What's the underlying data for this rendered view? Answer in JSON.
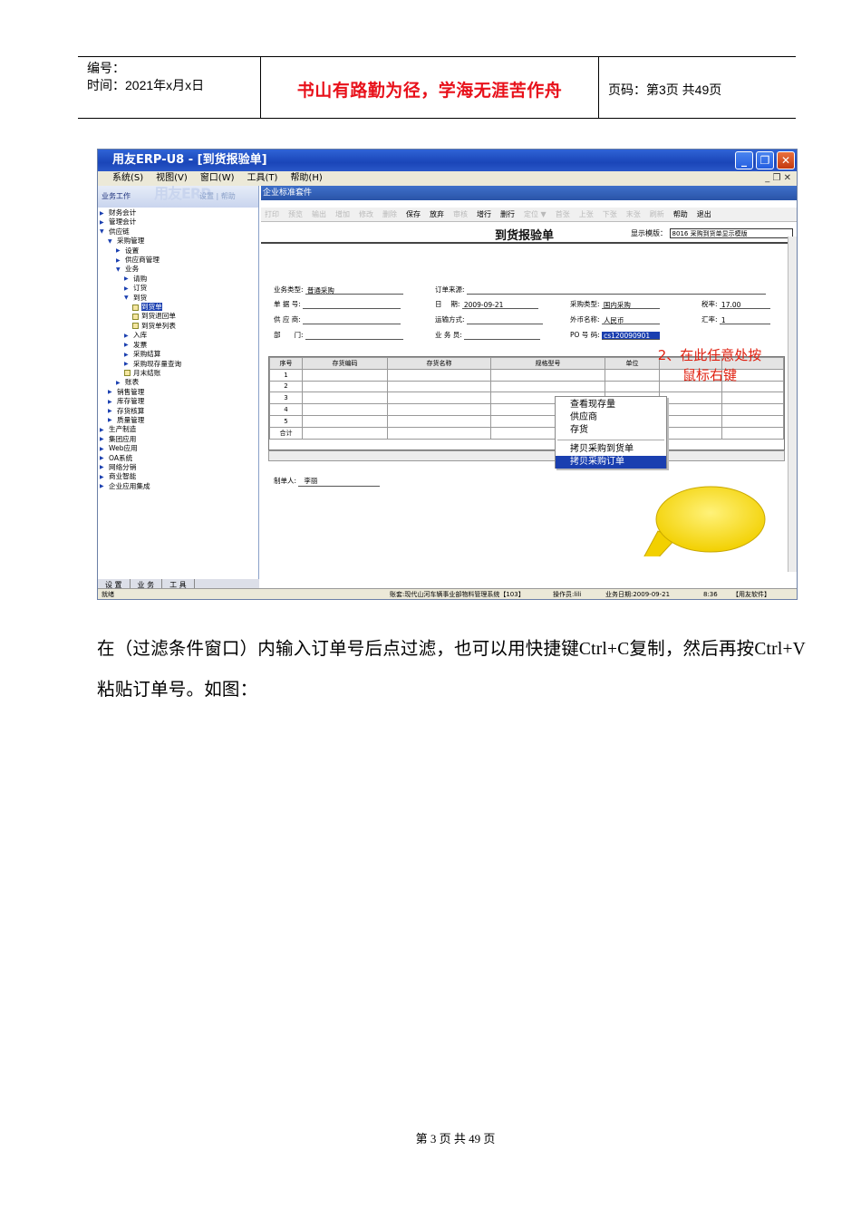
{
  "header": {
    "serial_label": "编号：",
    "time_label": "时间：2021年x月x日",
    "motto": "书山有路勤为径，学海无涯苦作舟",
    "page_info": "页码：第3页 共49页"
  },
  "app": {
    "window_title": "用友ERP-U8 - [到货报验单]",
    "menus": [
      "系统(S)",
      "视图(V)",
      "窗口(W)",
      "工具(T)",
      "帮助(H)"
    ],
    "menu_right": "_ ❐ ✕",
    "sidebar_title": "业务工作",
    "sidebar_links": "设置 | 帮助",
    "sidebar_logo": "用友ERP",
    "tree": [
      {
        "label": "财务会计",
        "level": 0,
        "icon": "tri"
      },
      {
        "label": "管理会计",
        "level": 0,
        "icon": "tri"
      },
      {
        "label": "供应链",
        "level": 0,
        "icon": "open"
      },
      {
        "label": "采购管理",
        "level": 1,
        "icon": "open"
      },
      {
        "label": "设置",
        "level": 2,
        "icon": "tri"
      },
      {
        "label": "供应商管理",
        "level": 2,
        "icon": "tri"
      },
      {
        "label": "业务",
        "level": 2,
        "icon": "open"
      },
      {
        "label": "请购",
        "level": 3,
        "icon": "tri"
      },
      {
        "label": "订货",
        "level": 3,
        "icon": "tri"
      },
      {
        "label": "到货",
        "level": 3,
        "icon": "open"
      },
      {
        "label": "到货单",
        "level": 4,
        "icon": "doc",
        "selected": true
      },
      {
        "label": "到货退回单",
        "level": 4,
        "icon": "doc"
      },
      {
        "label": "到货单列表",
        "level": 4,
        "icon": "doc"
      },
      {
        "label": "入库",
        "level": 3,
        "icon": "tri"
      },
      {
        "label": "发票",
        "level": 3,
        "icon": "tri"
      },
      {
        "label": "采购结算",
        "level": 3,
        "icon": "tri"
      },
      {
        "label": "采购现存量查询",
        "level": 3,
        "icon": "tri"
      },
      {
        "label": "月末结账",
        "level": 3,
        "icon": "doc"
      },
      {
        "label": "账表",
        "level": 2,
        "icon": "tri"
      },
      {
        "label": "销售管理",
        "level": 1,
        "icon": "tri"
      },
      {
        "label": "库存管理",
        "level": 1,
        "icon": "tri"
      },
      {
        "label": "存货核算",
        "level": 1,
        "icon": "tri"
      },
      {
        "label": "质量管理",
        "level": 1,
        "icon": "tri"
      },
      {
        "label": "生产制造",
        "level": 0,
        "icon": "tri"
      },
      {
        "label": "集团应用",
        "level": 0,
        "icon": "tri"
      },
      {
        "label": "Web应用",
        "level": 0,
        "icon": "tri"
      },
      {
        "label": "OA系统",
        "level": 0,
        "icon": "tri"
      },
      {
        "label": "网络分销",
        "level": 0,
        "icon": "tri"
      },
      {
        "label": "商业智能",
        "level": 0,
        "icon": "tri"
      },
      {
        "label": "企业应用集成",
        "level": 0,
        "icon": "tri"
      }
    ],
    "side_tabs": [
      "设 置",
      "业 务",
      "工 具"
    ],
    "app_bar": "企业标准套件",
    "toolbar": [
      {
        "label": "打印",
        "on": false
      },
      {
        "label": "预览",
        "on": false
      },
      {
        "label": "输出",
        "on": false
      },
      {
        "label": "增加",
        "on": false
      },
      {
        "label": "修改",
        "on": false
      },
      {
        "label": "删除",
        "on": false
      },
      {
        "label": "保存",
        "on": true
      },
      {
        "label": "放弃",
        "on": true
      },
      {
        "label": "审核",
        "on": false
      },
      {
        "label": "增行",
        "on": true
      },
      {
        "label": "删行",
        "on": true
      },
      {
        "label": "定位 ▼",
        "on": false
      },
      {
        "label": "首张",
        "on": false
      },
      {
        "label": "上张",
        "on": false
      },
      {
        "label": "下张",
        "on": false
      },
      {
        "label": "末张",
        "on": false
      },
      {
        "label": "刷新",
        "on": false
      },
      {
        "label": "帮助",
        "on": true
      },
      {
        "label": "退出",
        "on": true
      }
    ],
    "form_title": "到货报验单",
    "template_label": "显示模版：",
    "template_value": "8016 采购到货单显示模版",
    "fields": {
      "biz_type_label": "业务类型:",
      "biz_type_value": "普通采购",
      "order_source_label": "订单来源:",
      "doc_no_label": "单 据 号:",
      "date_label": "日　 期:",
      "date_value": "2009-09-21",
      "purchase_type_label": "采购类型:",
      "purchase_type_value": "国内采购",
      "tax_label": "税率:",
      "tax_value": "17.00",
      "supplier_label": "供 应 商:",
      "transport_label": "运输方式:",
      "currency_label": "外币名称:",
      "currency_value": "人民币",
      "rate_label": "汇率:",
      "rate_value": "1",
      "dept_label": "部　　门:",
      "clerk_label": "业 务 员:",
      "po_label": "PO 号 码:",
      "po_value": "cs120090901"
    },
    "grid_headers": [
      "序号",
      "存货编码",
      "存货名称",
      "规格型号",
      "单位"
    ],
    "grid_rows": [
      "1",
      "2",
      "3",
      "4",
      "5",
      "合计"
    ],
    "maker_label": "制单人:",
    "maker_value": "李丽",
    "context_menu": [
      "查看现存量",
      "供应商",
      "存货",
      "拷贝采购到货单",
      "拷贝采购订单"
    ],
    "callout": "2、在此任意处按鼠标右键",
    "status": {
      "ready": "就绪",
      "account": "账套:现代山河车辆事业部物料管理系统【103】",
      "operator": "操作员:lili",
      "biz_date": "业务日期:2009-09-21",
      "time": "8:36",
      "brand": "【用友软件】"
    }
  },
  "paragraph": "在（过滤条件窗口）内输入订单号后点过滤，也可以用快捷键Ctrl+C复制，然后再按Ctrl+V粘贴订单号。如图：",
  "footer": "第 3 页 共 49 页"
}
